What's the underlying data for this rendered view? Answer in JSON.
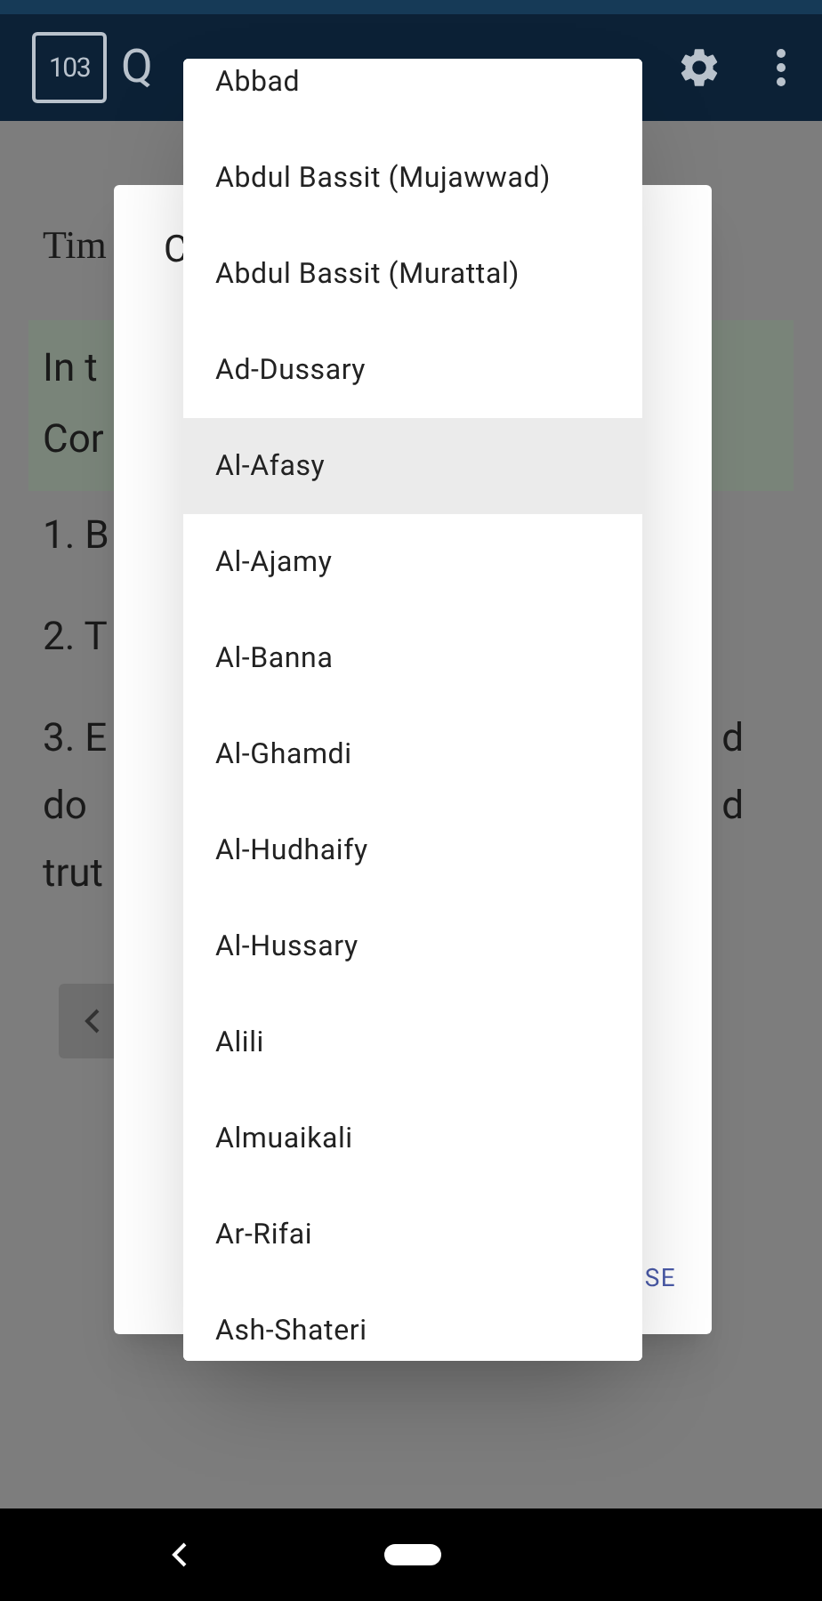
{
  "app_bar": {
    "badge": "103",
    "title": "Q"
  },
  "page": {
    "heading": "Tim",
    "highlight_lines": [
      "In t",
      "Cor"
    ],
    "paragraphs": [
      {
        "lines": [
          {
            "left": "1. B"
          }
        ]
      },
      {
        "lines": [
          {
            "left": "2. T"
          }
        ]
      },
      {
        "lines": [
          {
            "left": "3. E",
            "right": "d"
          },
          {
            "left": "do",
            "right": "d"
          },
          {
            "left": "trut"
          }
        ]
      }
    ]
  },
  "dialog": {
    "title": "C",
    "button": "SE"
  },
  "dropdown": {
    "items": [
      {
        "label": "Abbad",
        "selected": false
      },
      {
        "label": "Abdul Bassit (Mujawwad)",
        "selected": false
      },
      {
        "label": "Abdul Bassit (Murattal)",
        "selected": false
      },
      {
        "label": "Ad-Dussary",
        "selected": false
      },
      {
        "label": "Al-Afasy",
        "selected": true
      },
      {
        "label": "Al-Ajamy",
        "selected": false
      },
      {
        "label": "Al-Banna",
        "selected": false
      },
      {
        "label": "Al-Ghamdi",
        "selected": false
      },
      {
        "label": "Al-Hudhaify",
        "selected": false
      },
      {
        "label": "Al-Hussary",
        "selected": false
      },
      {
        "label": "Alili",
        "selected": false
      },
      {
        "label": "Almuaikali",
        "selected": false
      },
      {
        "label": "Ar-Rifai",
        "selected": false
      },
      {
        "label": "Ash-Shateri",
        "selected": false
      }
    ]
  }
}
